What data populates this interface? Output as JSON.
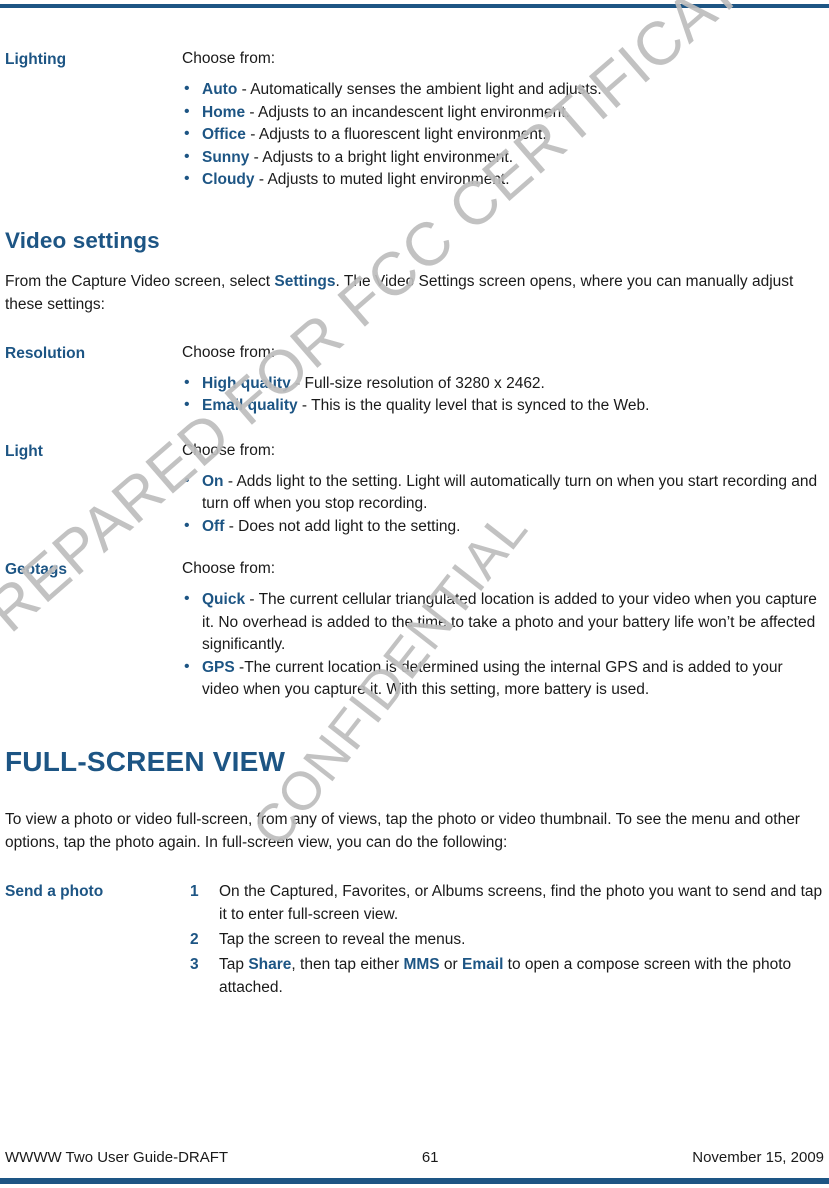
{
  "page": {
    "accent_color": "#1d5584",
    "text_color": "#1a1a1a",
    "watermark_color": "#bdbdbd"
  },
  "watermarks": {
    "primary": "PREPARED FOR FCC CERTIFICATION",
    "secondary": "CONFIDENTIAL"
  },
  "sections": {
    "lighting": {
      "term": "Lighting",
      "intro": "Choose from:",
      "items": [
        {
          "kw": "Auto",
          "text": " - Automatically senses the ambient light and adjusts."
        },
        {
          "kw": "Home",
          "text": " - Adjusts to an incandescent light environment."
        },
        {
          "kw": "Office",
          "text": " - Adjusts to a fluorescent light environment."
        },
        {
          "kw": "Sunny",
          "text": " - Adjusts to a bright light environment."
        },
        {
          "kw": "Cloudy",
          "text": " - Adjusts to muted light environment."
        }
      ]
    },
    "video_settings": {
      "heading": "Video settings",
      "lead_pre": "From the Capture Video screen, select ",
      "lead_kw": "Settings",
      "lead_post": ". The Video Settings screen opens, where you can manually adjust these settings:"
    },
    "resolution": {
      "term": "Resolution",
      "intro": "Choose from:",
      "items": [
        {
          "kw": "High quality",
          "text": " - Full-size resolution of 3280 x 2462."
        },
        {
          "kw": "Email quality",
          "text": " - This is the quality level that is synced to the Web."
        }
      ]
    },
    "light": {
      "term": "Light",
      "intro": "Choose from:",
      "items": [
        {
          "kw": "On",
          "text": " - Adds light to the setting. Light will automatically turn on when you start recording and turn off when you stop recording."
        },
        {
          "kw": "Off",
          "text": " - Does not add light to the setting."
        }
      ]
    },
    "geotags": {
      "term": "Geotags",
      "intro": "Choose from:",
      "items": [
        {
          "kw": "Quick",
          "text": " - The current cellular triangulated location is added to your video when you capture it. No overhead is added to the time to take a photo and your battery life won’t be affected significantly."
        },
        {
          "kw": "GPS",
          "text": " -The current location is determined using the internal GPS and is added to your video when you capture it. With this setting, more battery is used."
        }
      ]
    },
    "full_screen_view": {
      "heading": "FULL-SCREEN VIEW",
      "lead": "To view a photo or video full-screen, from any of views, tap the photo or video thumbnail. To see the menu and other options, tap the photo again. In full-screen view, you can do the following:"
    },
    "send_a_photo": {
      "term": "Send a photo",
      "steps": [
        {
          "num": "1",
          "parts": [
            {
              "type": "plain",
              "text": "On the Captured, Favorites, or Albums screens, find the photo you want to send and tap it to enter full-screen view."
            }
          ]
        },
        {
          "num": "2",
          "parts": [
            {
              "type": "plain",
              "text": "Tap the screen to reveal the menus."
            }
          ]
        },
        {
          "num": "3",
          "parts": [
            {
              "type": "plain",
              "text": "Tap "
            },
            {
              "type": "kw",
              "text": "Share"
            },
            {
              "type": "plain",
              "text": ", then tap either "
            },
            {
              "type": "kw",
              "text": "MMS"
            },
            {
              "type": "plain",
              "text": " or "
            },
            {
              "type": "kw",
              "text": "Email"
            },
            {
              "type": "plain",
              "text": " to open a compose screen with the photo attached."
            }
          ]
        }
      ]
    }
  },
  "footer": {
    "left": "WWWW Two User Guide-DRAFT",
    "page_number": "61",
    "right": "November 15, 2009"
  }
}
